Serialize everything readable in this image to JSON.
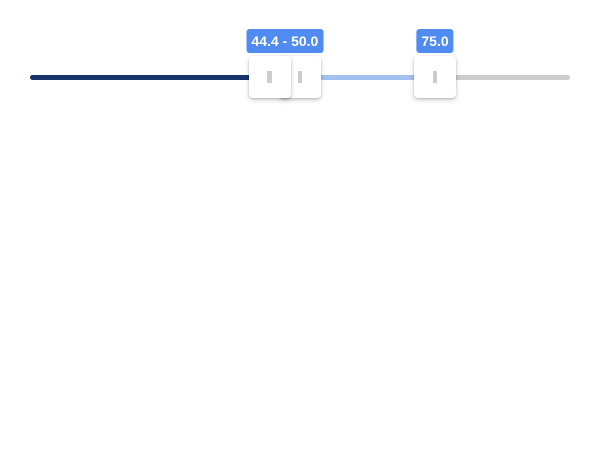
{
  "slider": {
    "min": 0,
    "max": 100,
    "values": [
      44.4,
      50.0,
      75.0
    ],
    "tooltips": {
      "merged": "44.4 - 50.0",
      "third": "75.0"
    },
    "colors": {
      "track_rest": "#cccccc",
      "track_low": "#16346b",
      "track_range": "#a3c1f0",
      "tooltip_bg": "#4f8bf0",
      "handle_bg": "#ffffff",
      "grip": "#cccccc"
    },
    "icons": {
      "grip": "vertical-bar-grip-icon"
    }
  }
}
